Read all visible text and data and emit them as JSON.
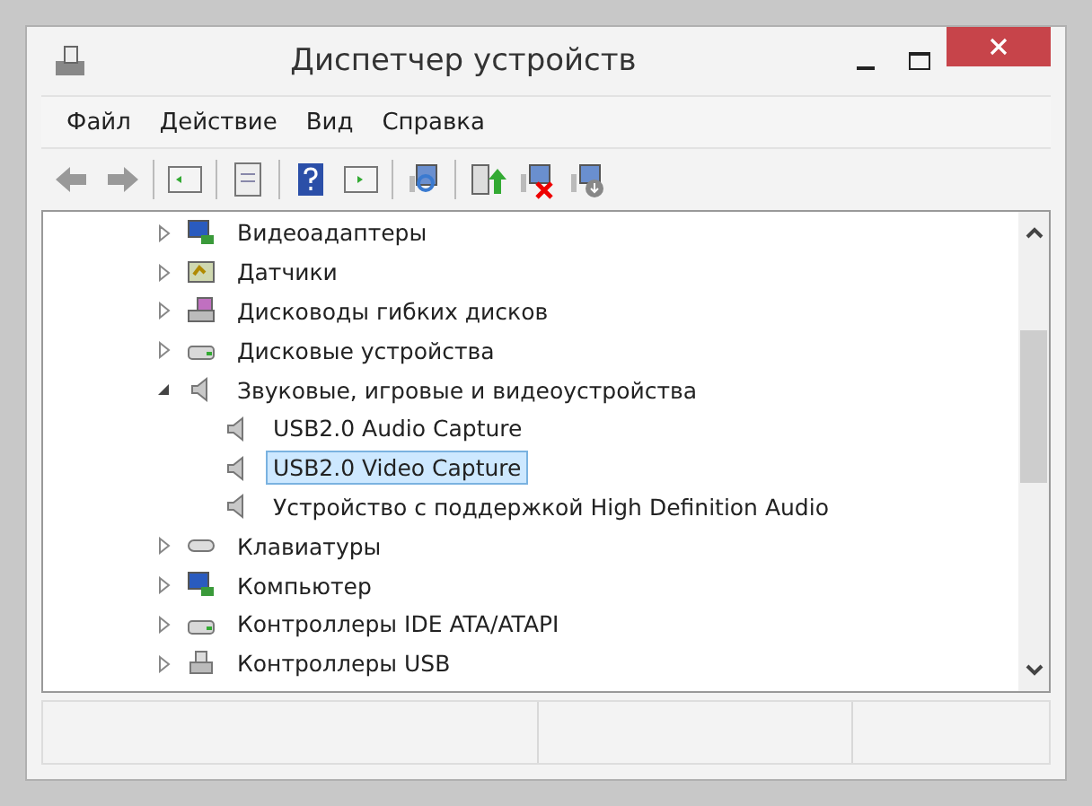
{
  "window": {
    "title": "Диспетчер устройств"
  },
  "menu": [
    "Файл",
    "Действие",
    "Вид",
    "Справка"
  ],
  "tree": [
    {
      "label": "Видеоадаптеры",
      "kind": "monitor",
      "expanded": false
    },
    {
      "label": "Датчики",
      "kind": "sensor",
      "expanded": false
    },
    {
      "label": "Дисководы гибких дисков",
      "kind": "floppy",
      "expanded": false
    },
    {
      "label": "Дисковые устройства",
      "kind": "disk",
      "expanded": false
    },
    {
      "label": "Звуковые, игровые и видеоустройства",
      "kind": "speaker",
      "expanded": true,
      "children": [
        {
          "label": "USB2.0 Audio Capture",
          "kind": "speaker",
          "selected": false
        },
        {
          "label": "USB2.0 Video Capture",
          "kind": "speaker",
          "selected": true
        },
        {
          "label": "Устройство с поддержкой High Definition Audio",
          "kind": "speaker",
          "selected": false
        }
      ]
    },
    {
      "label": "Клавиатуры",
      "kind": "keyboard",
      "expanded": false
    },
    {
      "label": "Компьютер",
      "kind": "monitor",
      "expanded": false
    },
    {
      "label": "Контроллеры IDE ATA/ATAPI",
      "kind": "disk",
      "expanded": false
    },
    {
      "label": "Контроллеры USB",
      "kind": "usb",
      "expanded": false
    }
  ]
}
